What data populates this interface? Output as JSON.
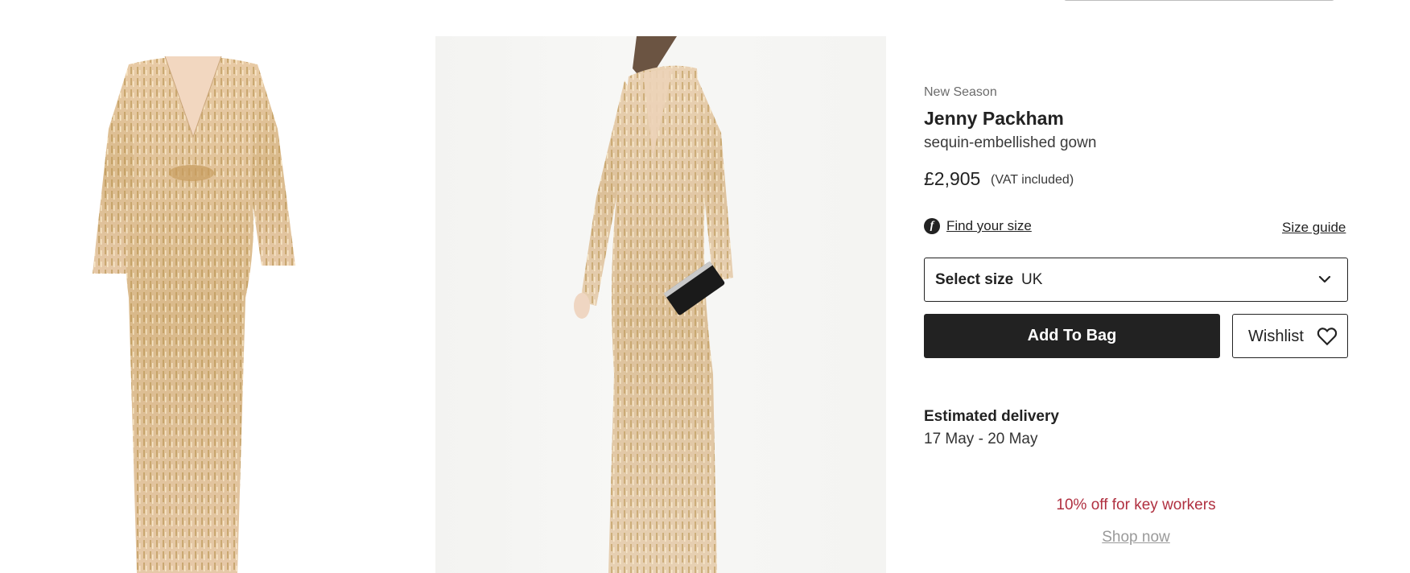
{
  "product": {
    "label": "New Season",
    "brand": "Jenny Packham",
    "name": "sequin-embellished gown",
    "price": "£2,905",
    "vat_note": "(VAT included)"
  },
  "sizing": {
    "fit_icon": "f-logo-icon",
    "find_size_label": "Find your size",
    "size_guide_label": "Size guide",
    "select_label": "Select size",
    "select_value": "UK"
  },
  "actions": {
    "add_to_bag_label": "Add To Bag",
    "wishlist_label": "Wishlist"
  },
  "delivery": {
    "title": "Estimated delivery",
    "dates": "17 May - 20 May"
  },
  "promo": {
    "text": "10% off for key workers",
    "link_label": "Shop now"
  },
  "images": {
    "left": "gown-flatlay-image",
    "center": "gown-model-image"
  },
  "colors": {
    "primary": "#222222",
    "promo": "#b03040",
    "muted": "#9a9a9a",
    "gold": "#d9b98a"
  }
}
